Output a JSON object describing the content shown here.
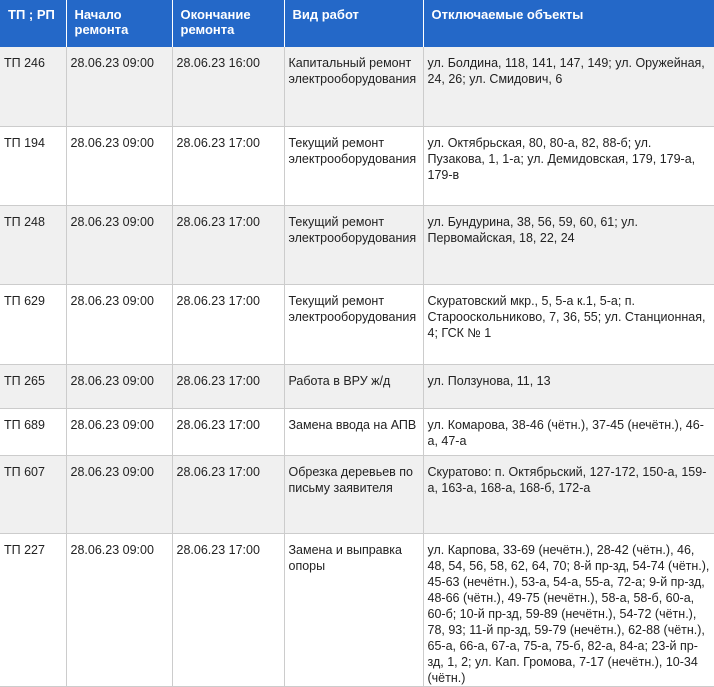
{
  "headers": [
    "ТП ; РП",
    "Начало ремонта",
    "Окончание ремонта",
    "Вид работ",
    "Отключаемые объекты"
  ],
  "rows": [
    {
      "tp": "ТП 246",
      "start": "28.06.23 09:00",
      "end": "28.06.23 16:00",
      "work": "Капитальный ремонт электрооборудования",
      "objects": "ул. Болдина, 118, 141, 147, 149; ул. Оружейная, 24, 26; ул. Смидович, 6"
    },
    {
      "tp": "ТП 194",
      "start": "28.06.23 09:00",
      "end": "28.06.23 17:00",
      "work": "Текущий ремонт электрооборудования",
      "objects": "ул. Октябрьская, 80, 80-а, 82, 88-б; ул. Пузакова, 1, 1-а; ул. Демидовская, 179, 179-а, 179-в"
    },
    {
      "tp": "ТП 248",
      "start": "28.06.23 09:00",
      "end": "28.06.23 17:00",
      "work": "Текущий ремонт электрооборудования",
      "objects": "ул. Бундурина, 38, 56, 59, 60, 61; ул. Первомайская, 18, 22, 24"
    },
    {
      "tp": "ТП 629",
      "start": "28.06.23 09:00",
      "end": "28.06.23 17:00",
      "work": "Текущий ремонт электрооборудования",
      "objects": "Скуратовский мкр., 5, 5-а к.1, 5-а; п. Старооскольниково, 7, 36, 55; ул. Станционная, 4; ГСК № 1"
    },
    {
      "tp": "ТП 265",
      "start": "28.06.23 09:00",
      "end": "28.06.23 17:00",
      "work": "Работа в ВРУ ж/д",
      "objects": "ул. Ползунова, 11, 13"
    },
    {
      "tp": "ТП 689",
      "start": "28.06.23 09:00",
      "end": "28.06.23 17:00",
      "work": "Замена ввода на АПВ",
      "objects": "ул. Комарова, 38-46 (чётн.), 37-45 (нечётн.), 46-а, 47-а"
    },
    {
      "tp": "ТП 607",
      "start": "28.06.23 09:00",
      "end": "28.06.23 17:00",
      "work": "Обрезка деревьев по письму заявителя",
      "objects": "Скуратово: п. Октябрьский, 127-172, 150-а, 159-а, 163-а, 168-а, 168-б, 172-а"
    },
    {
      "tp": "ТП 227",
      "start": "28.06.23 09:00",
      "end": "28.06.23 17:00",
      "work": "Замена и выправка опоры",
      "objects": "ул. Карпова, 33-69 (нечётн.), 28-42 (чётн.), 46, 48, 54, 56, 58, 62, 64, 70; 8-й пр-зд, 54-74 (чётн.), 45-63 (нечётн.), 53-а, 54-а, 55-а, 72-а; 9-й пр-зд, 48-66 (чётн.), 49-75 (нечётн.), 58-а, 58-б, 60-а, 60-б; 10-й пр-зд, 59-89 (нечётн.), 54-72 (чётн.), 78, 93; 11-й пр-зд, 59-79 (нечётн.), 62-88 (чётн.), 65-а, 66-а, 67-а, 75-а, 75-б, 82-а, 84-а; 23-й пр-зд, 1, 2; ул. Кап. Громова, 7-17 (нечётн.), 10-34 (чётн.)"
    }
  ],
  "colors": {
    "header_bg": "#2468c8",
    "odd_row": "#f0f0f0",
    "even_row": "#ffffff"
  }
}
